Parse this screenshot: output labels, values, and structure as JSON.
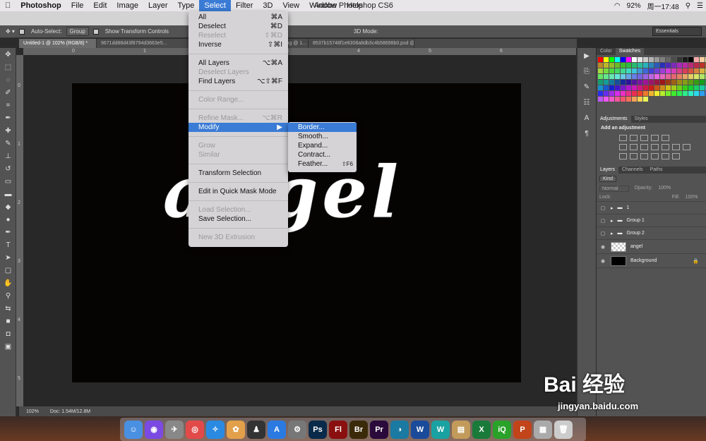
{
  "mac_menubar": {
    "app": "Photoshop",
    "items": [
      "File",
      "Edit",
      "Image",
      "Layer",
      "Type",
      "Select",
      "Filter",
      "3D",
      "View",
      "Window",
      "Help"
    ],
    "active_item": "Select",
    "window_title": "Adobe Photoshop CS6",
    "battery": "92%",
    "clock": "周一17:48"
  },
  "options_bar": {
    "auto_select_label": "Auto-Select:",
    "auto_select_value": "Group",
    "show_transform_label": "Show Transform Controls",
    "mode_3d_label": "3D Mode:",
    "workspace": "Essentials"
  },
  "document_tabs": [
    "Untitled-1 @ 102% (RGB/8) *",
    "9671dd88d43f8794d3663e5...",
    "619012,2615057392&fm=21&gp=0.jpg @ 1...",
    "8537b15748f1e8308a8db3c4b58698b0.psd @ 53.5..."
  ],
  "ruler": {
    "h_ticks": [
      "0",
      "1",
      "2",
      "3",
      "4",
      "5",
      "6"
    ],
    "v_ticks": [
      "0",
      "1",
      "2",
      "3",
      "4",
      "5"
    ]
  },
  "canvas_text": "angel",
  "status": {
    "zoom": "102%",
    "doc": "Doc: 1.54M/12.8M"
  },
  "select_menu": [
    {
      "label": "All",
      "shortcut": "⌘A",
      "enabled": true
    },
    {
      "label": "Deselect",
      "shortcut": "⌘D",
      "enabled": true
    },
    {
      "label": "Reselect",
      "shortcut": "⇧⌘D",
      "enabled": false
    },
    {
      "label": "Inverse",
      "shortcut": "⇧⌘I",
      "enabled": true
    },
    {
      "sep": true
    },
    {
      "label": "All Layers",
      "shortcut": "⌥⌘A",
      "enabled": true
    },
    {
      "label": "Deselect Layers",
      "shortcut": "",
      "enabled": false
    },
    {
      "label": "Find Layers",
      "shortcut": "⌥⇧⌘F",
      "enabled": true
    },
    {
      "sep": true
    },
    {
      "label": "Color Range...",
      "shortcut": "",
      "enabled": false
    },
    {
      "sep": true
    },
    {
      "label": "Refine Mask...",
      "shortcut": "⌥⌘R",
      "enabled": false
    },
    {
      "label": "Modify",
      "shortcut": "▶",
      "enabled": true,
      "highlight": true
    },
    {
      "sep": true
    },
    {
      "label": "Grow",
      "shortcut": "",
      "enabled": false
    },
    {
      "label": "Similar",
      "shortcut": "",
      "enabled": false
    },
    {
      "sep": true
    },
    {
      "label": "Transform Selection",
      "shortcut": "",
      "enabled": true
    },
    {
      "sep": true
    },
    {
      "label": "Edit in Quick Mask Mode",
      "shortcut": "",
      "enabled": true
    },
    {
      "sep": true
    },
    {
      "label": "Load Selection...",
      "shortcut": "",
      "enabled": false
    },
    {
      "label": "Save Selection...",
      "shortcut": "",
      "enabled": true
    },
    {
      "sep": true
    },
    {
      "label": "New 3D Extrusion",
      "shortcut": "",
      "enabled": false
    }
  ],
  "modify_submenu": [
    {
      "label": "Border...",
      "shortcut": "",
      "highlight": true
    },
    {
      "label": "Smooth...",
      "shortcut": ""
    },
    {
      "label": "Expand...",
      "shortcut": ""
    },
    {
      "label": "Contract...",
      "shortcut": ""
    },
    {
      "label": "Feather...",
      "shortcut": "⇧F6"
    }
  ],
  "panels": {
    "color_tabs": [
      "Color",
      "Swatches"
    ],
    "adjust_tabs": [
      "Adjustments",
      "Styles"
    ],
    "add_adjustment": "Add an adjustment",
    "layer_tabs": [
      "Layers",
      "Channels",
      "Paths"
    ],
    "kind": "Kind",
    "blend": "Normal",
    "opacity_label": "Opacity:",
    "opacity": "100%",
    "lock_label": "Lock:",
    "fill_label": "Fill:",
    "fill": "100%",
    "layers": [
      {
        "name": "1",
        "type": "group",
        "visible": false
      },
      {
        "name": "Group 1",
        "type": "group",
        "visible": false
      },
      {
        "name": "Group 2",
        "type": "group",
        "visible": false
      },
      {
        "name": "angel",
        "type": "layer",
        "visible": true
      },
      {
        "name": "Background",
        "type": "background",
        "visible": true
      }
    ]
  },
  "watermark": {
    "big": "Bai  经验",
    "small": "jingyan.baidu.com"
  },
  "colors": {
    "accent": "#3a7bd5",
    "canvas": "#060303"
  }
}
